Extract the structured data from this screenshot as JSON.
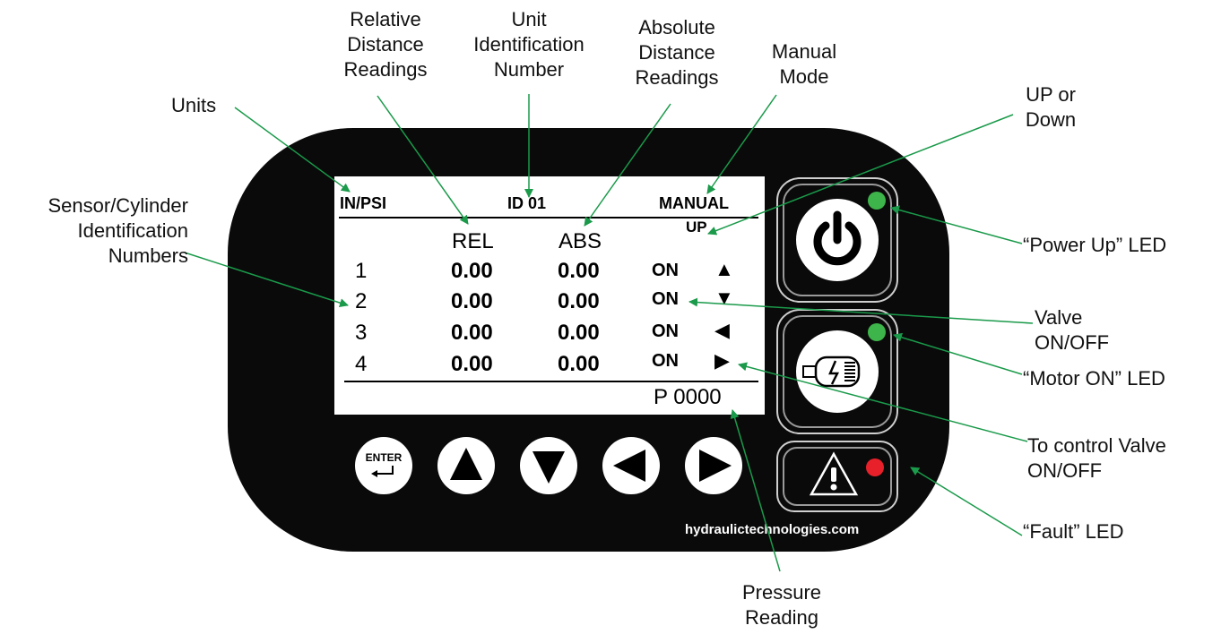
{
  "callouts": {
    "units": "Units",
    "relative_1": "Relative",
    "relative_2": "Distance",
    "relative_3": "Readings",
    "unit_id_1": "Unit",
    "unit_id_2": "Identification",
    "unit_id_3": "Number",
    "absolute_1": "Absolute",
    "absolute_2": "Distance",
    "absolute_3": "Readings",
    "manual_1": "Manual",
    "manual_2": "Mode",
    "updown_1": "UP or",
    "updown_2": "Down",
    "sensor_1": "Sensor/Cylinder",
    "sensor_2": "Identification",
    "sensor_3": "Numbers",
    "power_led": "“Power Up” LED",
    "valve_1": "Valve",
    "valve_2": "ON/OFF",
    "motor_led": "“Motor ON” LED",
    "control_1": "To control Valve",
    "control_2": "ON/OFF",
    "fault_led": "“Fault” LED",
    "pressure_1": "Pressure",
    "pressure_2": "Reading"
  },
  "lcd": {
    "units": "IN/PSI",
    "unit_id": "ID 01",
    "mode": "MANUAL",
    "direction": "UP",
    "col_rel": "REL",
    "col_abs": "ABS",
    "rows": [
      {
        "id": "1",
        "rel": "0.00",
        "abs": "0.00",
        "valve": "ON",
        "arrow": "▲"
      },
      {
        "id": "2",
        "rel": "0.00",
        "abs": "0.00",
        "valve": "ON",
        "arrow": "▼"
      },
      {
        "id": "3",
        "rel": "0.00",
        "abs": "0.00",
        "valve": "ON",
        "arrow": "◀"
      },
      {
        "id": "4",
        "rel": "0.00",
        "abs": "0.00",
        "valve": "ON",
        "arrow": "▶"
      }
    ],
    "pressure": "P 0000"
  },
  "buttons": {
    "enter_label": "ENTER",
    "up_icon": "up-arrow-icon",
    "down_icon": "down-arrow-icon",
    "left_icon": "left-arrow-icon",
    "right_icon": "right-arrow-icon",
    "power_icon": "power-icon",
    "motor_icon": "motor-icon",
    "fault_icon": "warning-icon"
  },
  "leds": {
    "power": "#3db54a",
    "motor": "#3db54a",
    "fault": "#e8202a"
  },
  "accent": "#1a9a4a",
  "website": "hydraulictechnologies.com"
}
